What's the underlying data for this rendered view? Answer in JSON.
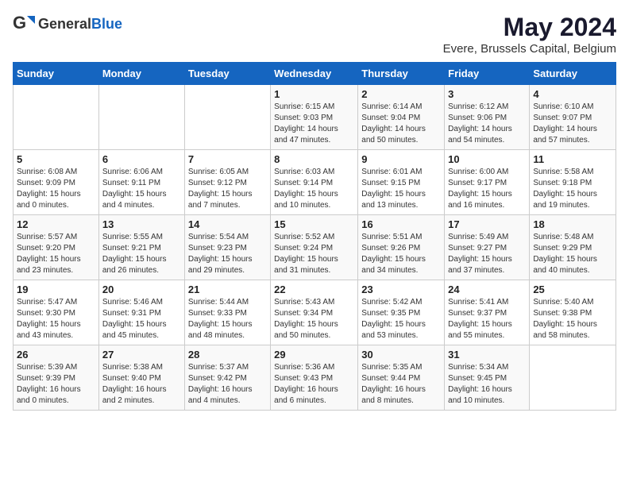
{
  "logo": {
    "text_general": "General",
    "text_blue": "Blue",
    "tagline": ""
  },
  "header": {
    "title": "May 2024",
    "subtitle": "Evere, Brussels Capital, Belgium"
  },
  "weekdays": [
    "Sunday",
    "Monday",
    "Tuesday",
    "Wednesday",
    "Thursday",
    "Friday",
    "Saturday"
  ],
  "weeks": [
    [
      {
        "day": "",
        "info": ""
      },
      {
        "day": "",
        "info": ""
      },
      {
        "day": "",
        "info": ""
      },
      {
        "day": "1",
        "info": "Sunrise: 6:15 AM\nSunset: 9:03 PM\nDaylight: 14 hours\nand 47 minutes."
      },
      {
        "day": "2",
        "info": "Sunrise: 6:14 AM\nSunset: 9:04 PM\nDaylight: 14 hours\nand 50 minutes."
      },
      {
        "day": "3",
        "info": "Sunrise: 6:12 AM\nSunset: 9:06 PM\nDaylight: 14 hours\nand 54 minutes."
      },
      {
        "day": "4",
        "info": "Sunrise: 6:10 AM\nSunset: 9:07 PM\nDaylight: 14 hours\nand 57 minutes."
      }
    ],
    [
      {
        "day": "5",
        "info": "Sunrise: 6:08 AM\nSunset: 9:09 PM\nDaylight: 15 hours\nand 0 minutes."
      },
      {
        "day": "6",
        "info": "Sunrise: 6:06 AM\nSunset: 9:11 PM\nDaylight: 15 hours\nand 4 minutes."
      },
      {
        "day": "7",
        "info": "Sunrise: 6:05 AM\nSunset: 9:12 PM\nDaylight: 15 hours\nand 7 minutes."
      },
      {
        "day": "8",
        "info": "Sunrise: 6:03 AM\nSunset: 9:14 PM\nDaylight: 15 hours\nand 10 minutes."
      },
      {
        "day": "9",
        "info": "Sunrise: 6:01 AM\nSunset: 9:15 PM\nDaylight: 15 hours\nand 13 minutes."
      },
      {
        "day": "10",
        "info": "Sunrise: 6:00 AM\nSunset: 9:17 PM\nDaylight: 15 hours\nand 16 minutes."
      },
      {
        "day": "11",
        "info": "Sunrise: 5:58 AM\nSunset: 9:18 PM\nDaylight: 15 hours\nand 19 minutes."
      }
    ],
    [
      {
        "day": "12",
        "info": "Sunrise: 5:57 AM\nSunset: 9:20 PM\nDaylight: 15 hours\nand 23 minutes."
      },
      {
        "day": "13",
        "info": "Sunrise: 5:55 AM\nSunset: 9:21 PM\nDaylight: 15 hours\nand 26 minutes."
      },
      {
        "day": "14",
        "info": "Sunrise: 5:54 AM\nSunset: 9:23 PM\nDaylight: 15 hours\nand 29 minutes."
      },
      {
        "day": "15",
        "info": "Sunrise: 5:52 AM\nSunset: 9:24 PM\nDaylight: 15 hours\nand 31 minutes."
      },
      {
        "day": "16",
        "info": "Sunrise: 5:51 AM\nSunset: 9:26 PM\nDaylight: 15 hours\nand 34 minutes."
      },
      {
        "day": "17",
        "info": "Sunrise: 5:49 AM\nSunset: 9:27 PM\nDaylight: 15 hours\nand 37 minutes."
      },
      {
        "day": "18",
        "info": "Sunrise: 5:48 AM\nSunset: 9:29 PM\nDaylight: 15 hours\nand 40 minutes."
      }
    ],
    [
      {
        "day": "19",
        "info": "Sunrise: 5:47 AM\nSunset: 9:30 PM\nDaylight: 15 hours\nand 43 minutes."
      },
      {
        "day": "20",
        "info": "Sunrise: 5:46 AM\nSunset: 9:31 PM\nDaylight: 15 hours\nand 45 minutes."
      },
      {
        "day": "21",
        "info": "Sunrise: 5:44 AM\nSunset: 9:33 PM\nDaylight: 15 hours\nand 48 minutes."
      },
      {
        "day": "22",
        "info": "Sunrise: 5:43 AM\nSunset: 9:34 PM\nDaylight: 15 hours\nand 50 minutes."
      },
      {
        "day": "23",
        "info": "Sunrise: 5:42 AM\nSunset: 9:35 PM\nDaylight: 15 hours\nand 53 minutes."
      },
      {
        "day": "24",
        "info": "Sunrise: 5:41 AM\nSunset: 9:37 PM\nDaylight: 15 hours\nand 55 minutes."
      },
      {
        "day": "25",
        "info": "Sunrise: 5:40 AM\nSunset: 9:38 PM\nDaylight: 15 hours\nand 58 minutes."
      }
    ],
    [
      {
        "day": "26",
        "info": "Sunrise: 5:39 AM\nSunset: 9:39 PM\nDaylight: 16 hours\nand 0 minutes."
      },
      {
        "day": "27",
        "info": "Sunrise: 5:38 AM\nSunset: 9:40 PM\nDaylight: 16 hours\nand 2 minutes."
      },
      {
        "day": "28",
        "info": "Sunrise: 5:37 AM\nSunset: 9:42 PM\nDaylight: 16 hours\nand 4 minutes."
      },
      {
        "day": "29",
        "info": "Sunrise: 5:36 AM\nSunset: 9:43 PM\nDaylight: 16 hours\nand 6 minutes."
      },
      {
        "day": "30",
        "info": "Sunrise: 5:35 AM\nSunset: 9:44 PM\nDaylight: 16 hours\nand 8 minutes."
      },
      {
        "day": "31",
        "info": "Sunrise: 5:34 AM\nSunset: 9:45 PM\nDaylight: 16 hours\nand 10 minutes."
      },
      {
        "day": "",
        "info": ""
      }
    ]
  ]
}
